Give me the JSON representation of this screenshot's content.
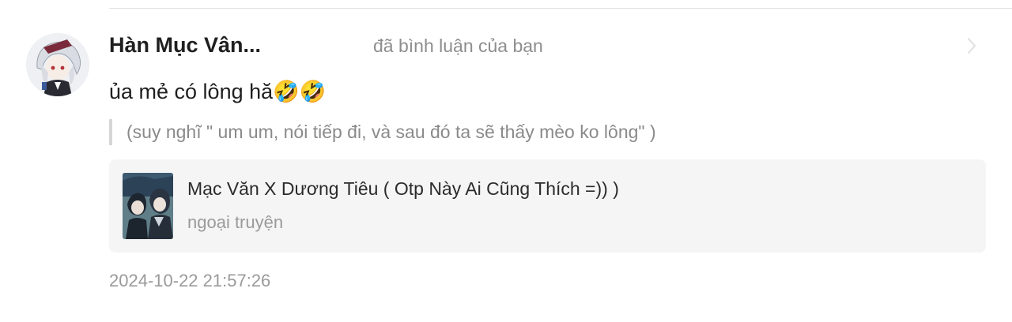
{
  "notification": {
    "user_name": "Hàn Mục Vân...",
    "action": "đã bình luận của bạn",
    "comment": "ủa mẻ có lông hă",
    "comment_emoji": "🤣🤣",
    "quoted": "(suy nghĩ \" um um, nói tiếp đi, và sau đó ta sẽ thấy mèo ko lông\" )",
    "timestamp": "2024-10-22 21:57:26"
  },
  "story": {
    "title": "Mạc Văn X Dương Tiêu ( Otp Này Ai Cũng Thích =)) )",
    "subtitle": "ngoại truyện"
  },
  "icons": {
    "chevron": "chevron-right-icon",
    "avatar": "avatar",
    "cover": "story-cover-thumbnail"
  },
  "colors": {
    "primary_text": "#1f1f1f",
    "secondary_text": "#8e8e8e",
    "card_background": "#f5f5f5",
    "quote_bar": "#d6d6d6"
  }
}
